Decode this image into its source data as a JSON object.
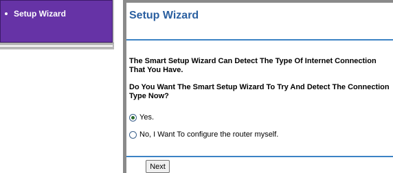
{
  "sidebar": {
    "items": [
      {
        "label": "Setup Wizard"
      }
    ]
  },
  "main": {
    "title": "Setup Wizard",
    "paragraph1": "The Smart Setup Wizard Can Detect The Type Of Internet Connection That You Have.",
    "paragraph2": "Do You Want The Smart Setup Wizard To Try And Detect The Connection Type Now?",
    "options": [
      {
        "label": "Yes.",
        "selected": true
      },
      {
        "label": "No, I Want To configure the router myself.",
        "selected": false
      }
    ],
    "next_label": "Next"
  },
  "colors": {
    "sidebar_bg": "#6633a6",
    "title": "#2a5fa0",
    "rule": "#3b82c4"
  }
}
